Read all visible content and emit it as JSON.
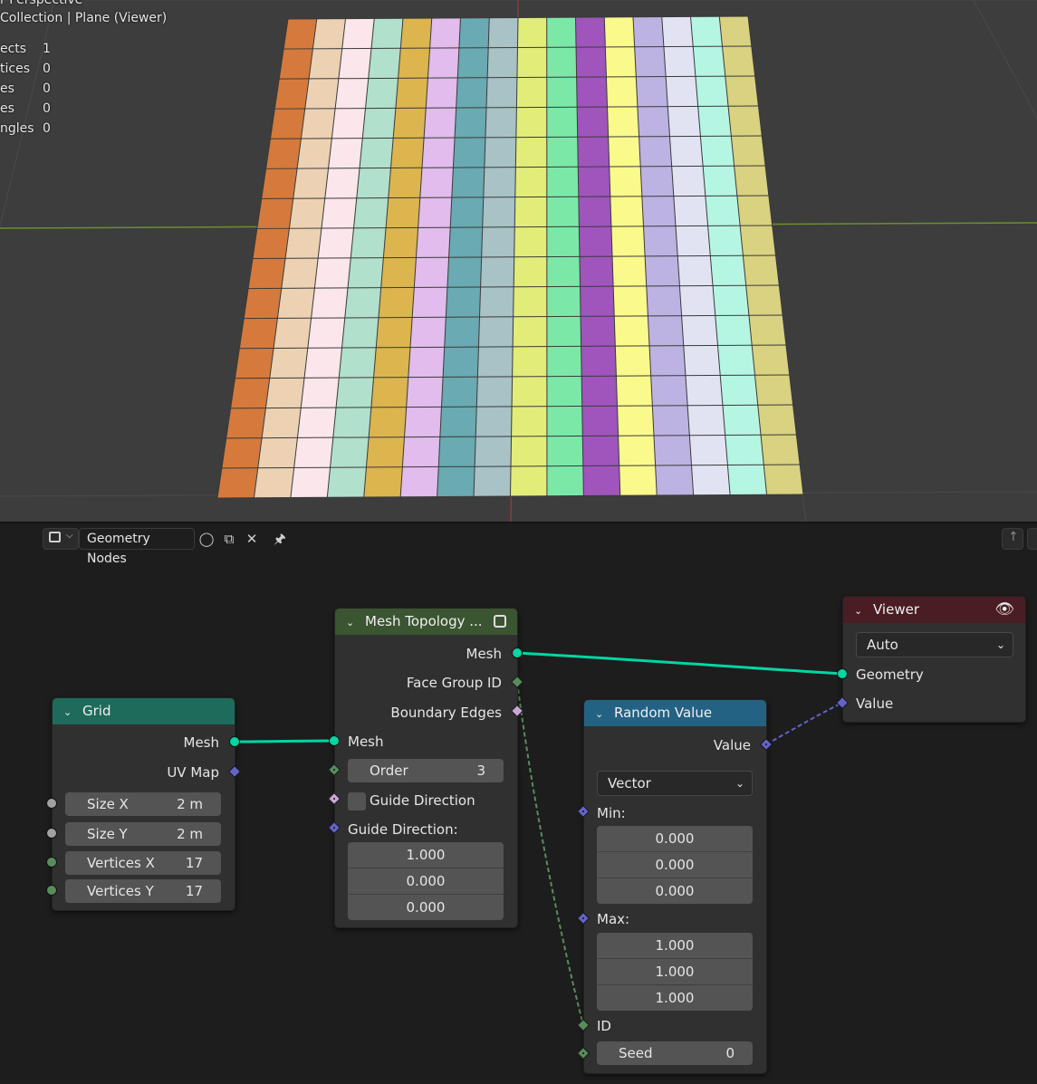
{
  "viewport": {
    "title": "r Perspective",
    "collection": "Collection | Plane (Viewer)",
    "stats": [
      {
        "label": "ects",
        "value": "1"
      },
      {
        "label": "tices",
        "value": "0"
      },
      {
        "label": "es",
        "value": "0"
      },
      {
        "label": "es",
        "value": "0"
      },
      {
        "label": "ngles",
        "value": "0"
      }
    ],
    "column_colors": [
      "#d57a3c",
      "#ecd2b3",
      "#fbe6ec",
      "#b1e0cc",
      "#dcb54f",
      "#e1bcec",
      "#6aaab2",
      "#a8c2c6",
      "#e2ec79",
      "#7be8a8",
      "#9f55bc",
      "#fafa8c",
      "#bcb3e2",
      "#e2e3f2",
      "#b5f6e3",
      "#d8d281"
    ],
    "rows": 16
  },
  "editor": {
    "tree_name": "Geometry Nodes"
  },
  "nodes": {
    "grid": {
      "title": "Grid",
      "out_mesh": "Mesh",
      "out_uvmap": "UV Map",
      "fields": [
        {
          "label": "Size X",
          "value": "2 m"
        },
        {
          "label": "Size Y",
          "value": "2 m"
        },
        {
          "label": "Vertices X",
          "value": "17"
        },
        {
          "label": "Vertices Y",
          "value": "17"
        }
      ]
    },
    "mesh_topology": {
      "title": "Mesh Topology ...",
      "out_mesh": "Mesh",
      "out_face_group_id": "Face Group ID",
      "out_boundary_edges": "Boundary Edges",
      "in_mesh": "Mesh",
      "order_label": "Order",
      "order_value": "3",
      "guide_checkbox_label": "Guide Direction",
      "guide_direction_label": "Guide Direction:",
      "guide_direction": [
        "1.000",
        "0.000",
        "0.000"
      ]
    },
    "random_value": {
      "title": "Random Value",
      "out_value": "Value",
      "type": "Vector",
      "min_label": "Min:",
      "min": [
        "0.000",
        "0.000",
        "0.000"
      ],
      "max_label": "Max:",
      "max": [
        "1.000",
        "1.000",
        "1.000"
      ],
      "id_label": "ID",
      "seed_label": "Seed",
      "seed_value": "0"
    },
    "viewer": {
      "title": "Viewer",
      "domain": "Auto",
      "in_geometry": "Geometry",
      "in_value": "Value"
    }
  },
  "colors": {
    "geometry_socket": "#00d6a3",
    "vector_socket": "#6363c7",
    "int_socket": "#598c5c",
    "float_socket": "#a1a1a1",
    "bool_socket": "#cca6d6",
    "grid_header": "#1e6b5c",
    "topology_header": "#3b5431",
    "random_header": "#246283",
    "viewer_header": "#4a1c24"
  }
}
